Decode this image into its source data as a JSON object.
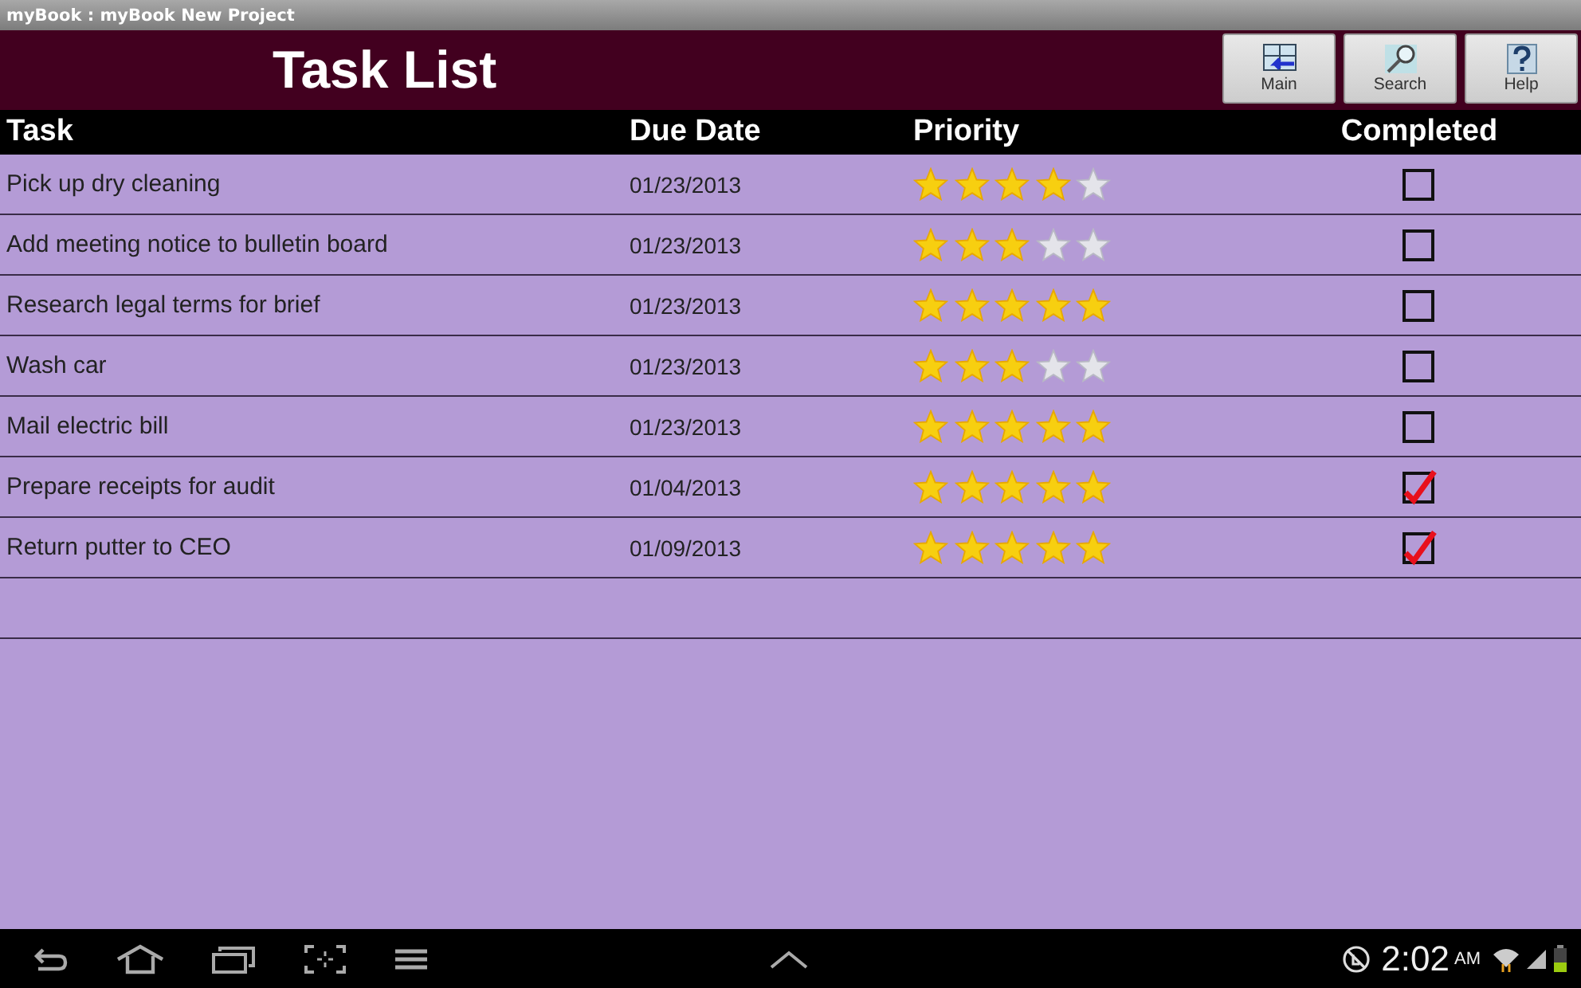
{
  "window": {
    "title": "myBook : myBook New Project"
  },
  "header": {
    "title": "Task List",
    "buttons": [
      {
        "label": "Main",
        "kind": "main"
      },
      {
        "label": "Search",
        "kind": "search"
      },
      {
        "label": "Help",
        "kind": "help"
      }
    ]
  },
  "table": {
    "columns": [
      "Task",
      "Due Date",
      "Priority",
      "Completed"
    ],
    "rows": [
      {
        "task": "Pick up dry cleaning",
        "due": "01/23/2013",
        "stars": 4,
        "checked": false
      },
      {
        "task": "Add meeting notice to bulletin board",
        "due": "01/23/2013",
        "stars": 3,
        "checked": false
      },
      {
        "task": "Research legal terms for brief",
        "due": "01/23/2013",
        "stars": 5,
        "checked": false
      },
      {
        "task": "Wash car",
        "due": "01/23/2013",
        "stars": 3,
        "checked": false
      },
      {
        "task": "Mail electric bill",
        "due": "01/23/2013",
        "stars": 5,
        "checked": false
      },
      {
        "task": "Prepare receipts for audit",
        "due": "01/04/2013",
        "stars": 5,
        "checked": true
      },
      {
        "task": "Return putter to CEO",
        "due": "01/09/2013",
        "stars": 5,
        "checked": true
      }
    ]
  },
  "status_bar": {
    "time": "2:02",
    "ampm": "AM"
  }
}
